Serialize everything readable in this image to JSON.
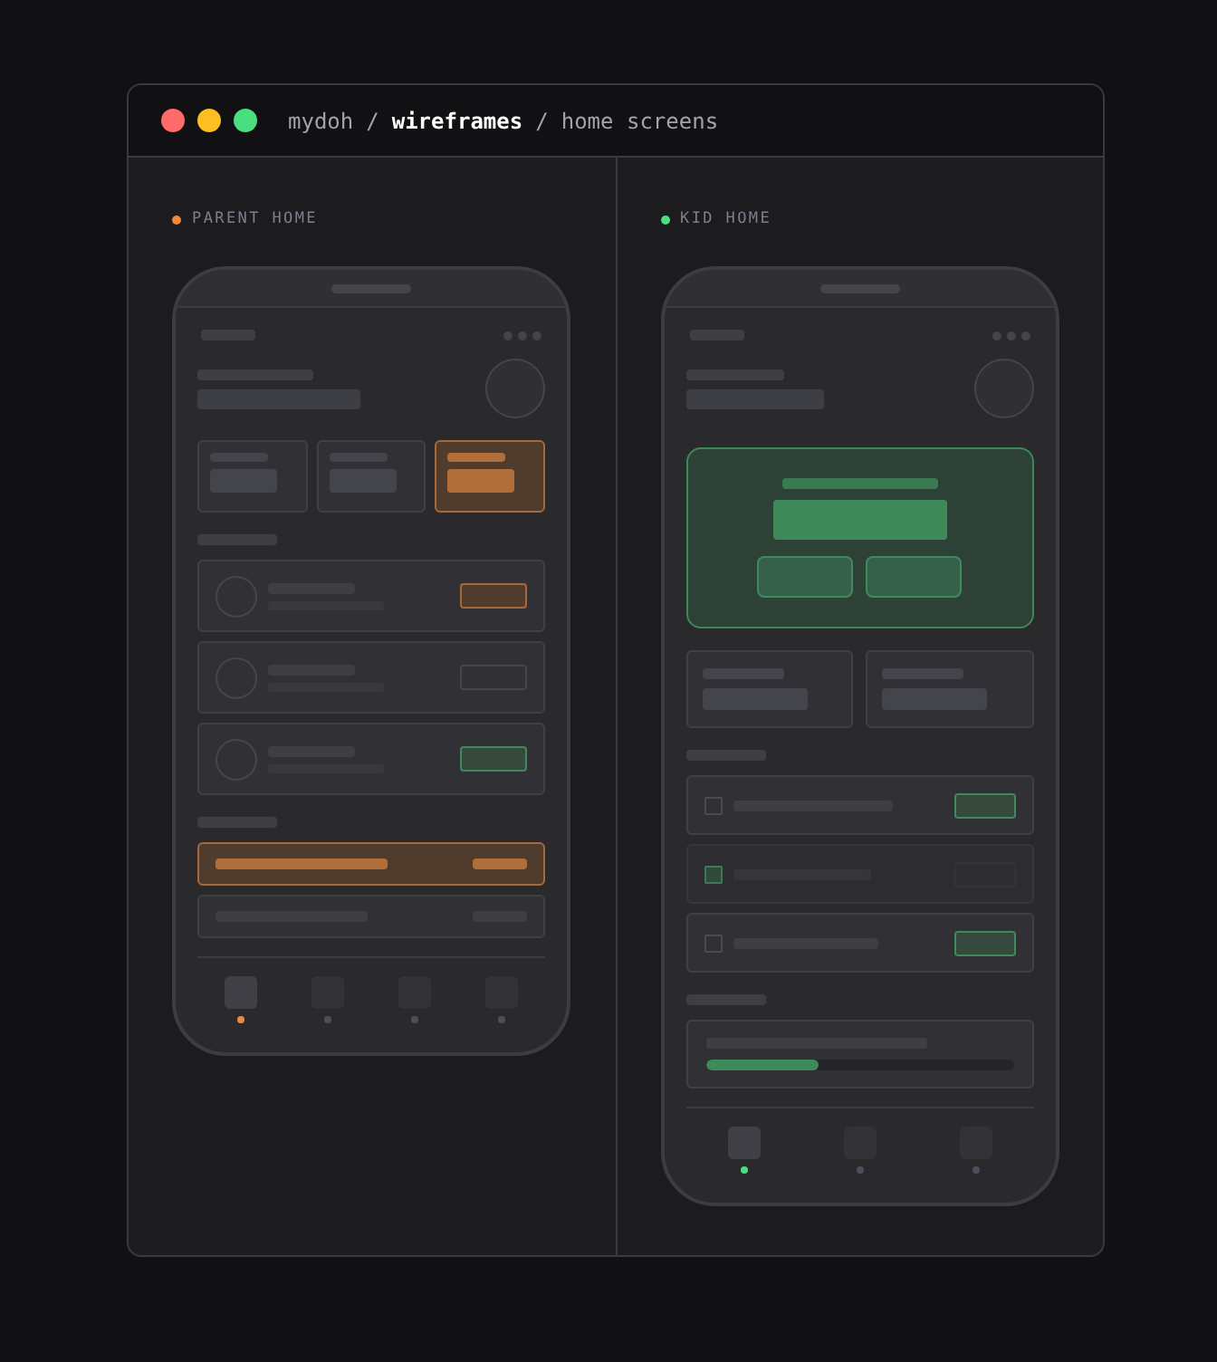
{
  "window": {
    "breadcrumbs": [
      {
        "text": "mydoh",
        "selected": false
      },
      {
        "text": "/",
        "selected": false
      },
      {
        "text": "wireframes",
        "selected": true
      },
      {
        "text": "/",
        "selected": false
      },
      {
        "text": "home screens",
        "selected": false
      }
    ]
  },
  "parent_home": {
    "label": "PARENT HOME",
    "color": "#f0883e",
    "stats": [
      {
        "selected": false
      },
      {
        "selected": false
      },
      {
        "selected": true
      }
    ],
    "tasks": [
      {
        "kind": "pending"
      },
      {
        "kind": "empty"
      },
      {
        "kind": "approved"
      }
    ],
    "payments": [
      {
        "selected": true
      },
      {
        "selected": false
      }
    ],
    "nav": [
      {
        "selected": true
      },
      {
        "selected": false
      },
      {
        "selected": false
      },
      {
        "selected": false
      }
    ]
  },
  "kid_home": {
    "label": "KID HOME",
    "color": "#4ade80",
    "chores": [
      {
        "done": false
      },
      {
        "done": true
      },
      {
        "done": false
      }
    ],
    "goal": {
      "level": 0.37
    },
    "nav": [
      {
        "selected": true
      },
      {
        "selected": false
      },
      {
        "selected": false
      }
    ]
  }
}
